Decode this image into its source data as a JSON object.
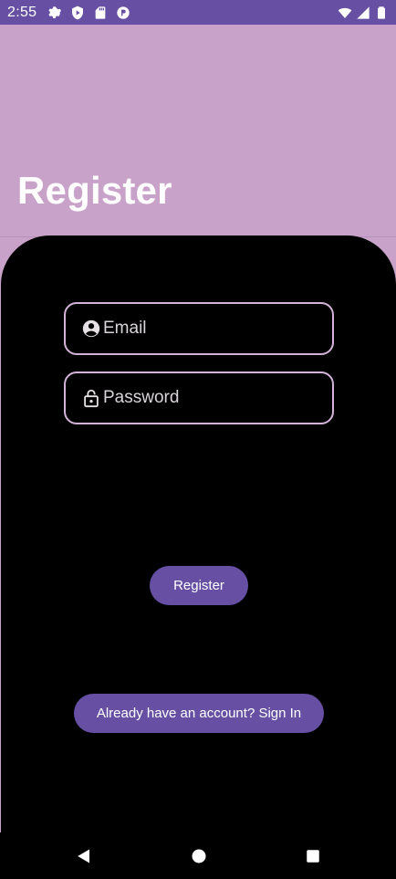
{
  "status_bar": {
    "time": "2:55",
    "left_icons": [
      "settings-icon",
      "play-protect-icon",
      "sd-card-icon",
      "app-notification-icon"
    ],
    "right_icons": [
      "wifi-icon",
      "signal-icon",
      "battery-icon"
    ]
  },
  "header": {
    "title": "Register"
  },
  "form": {
    "email": {
      "placeholder": "Email",
      "value": "",
      "icon": "account-circle-icon"
    },
    "password": {
      "placeholder": "Password",
      "value": "",
      "icon": "lock-open-icon"
    },
    "register_label": "Register",
    "signin_label": "Already have an account? Sign In"
  },
  "nav_bar": {
    "buttons": [
      "back-icon",
      "home-icon",
      "recents-icon"
    ]
  },
  "colors": {
    "primary": "#6750a4",
    "header_bg": "#c8a2c8",
    "panel_bg": "#000000",
    "field_border": "#d3b3d8"
  }
}
